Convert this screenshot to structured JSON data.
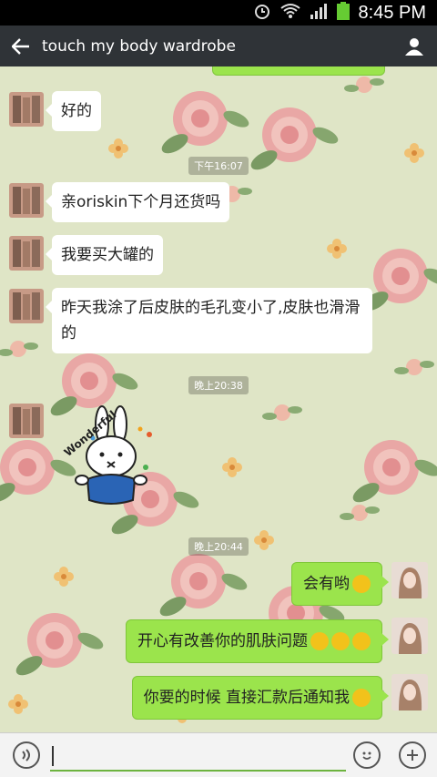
{
  "status_bar": {
    "time": "8:45 PM"
  },
  "header": {
    "title": "touch my body wardrobe"
  },
  "timestamps": [
    "下午16:07",
    "晚上20:38",
    "晚上20:44"
  ],
  "messages": [
    {
      "side": "left",
      "text": "好的"
    },
    {
      "side": "left",
      "text": "亲oriskin下个月还货吗"
    },
    {
      "side": "left",
      "text": "我要买大罐的"
    },
    {
      "side": "left",
      "text": "昨天我涂了后皮肤的毛孔变小了,皮肤也滑滑的"
    },
    {
      "side": "left",
      "sticker_text": "Wonderful"
    },
    {
      "side": "right",
      "text": "会有哟"
    },
    {
      "side": "right",
      "text": "开心有改善你的肌肤问题"
    },
    {
      "side": "right",
      "text": "你要的时候 直接汇款后通知我"
    }
  ]
}
